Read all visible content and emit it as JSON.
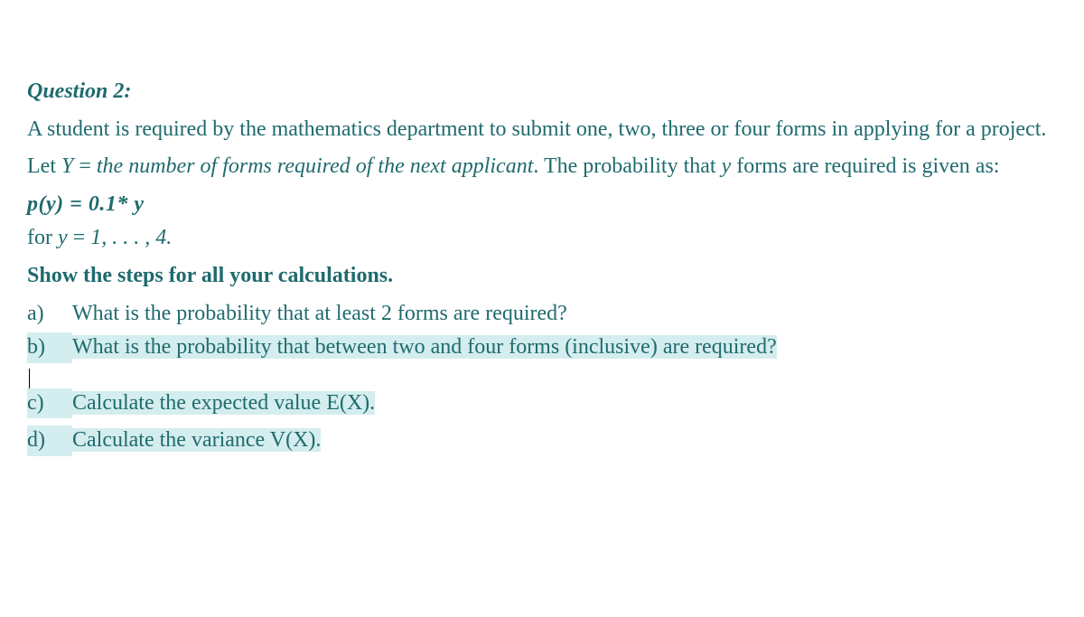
{
  "title": "Question 2:",
  "intro": "A student is required by the mathematics department to submit one, two, three or four forms in applying for a project.",
  "let_part1": "Let ",
  "let_var": "Y",
  "let_part2": " = ",
  "let_italic": "the number of forms required of the next applicant",
  "let_part3": ". The probability that ",
  "let_var2": "y",
  "let_part4": " forms are required is given as:",
  "formula": "p(y) = 0.1* y",
  "for_part1": "for ",
  "for_var": "y",
  "for_part2": " = ",
  "for_range": "1, . . . , 4.",
  "instruction": "Show the steps for all your calculations.",
  "items": {
    "a": {
      "label": "a)",
      "text": "What is the probability that at least 2 forms are required?"
    },
    "b": {
      "label": "b)",
      "text": "What is the probability that between two and four forms (inclusive) are required?"
    },
    "c": {
      "label": "c)",
      "text": "Calculate the expected value E(X)."
    },
    "d": {
      "label": "d)",
      "text": "Calculate the variance V(X)."
    }
  }
}
